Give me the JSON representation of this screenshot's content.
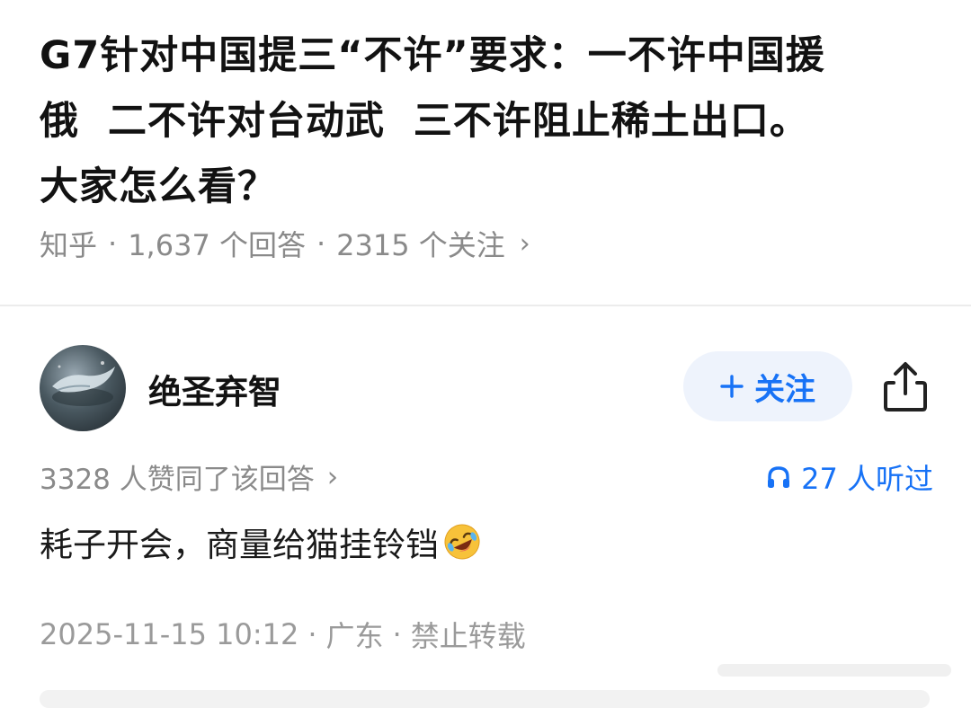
{
  "question": {
    "title_line1": "G7针对中国提三“不许”要求：一不许中国援",
    "title_line2": "俄  二不许对台动武  三不许阻止稀土出口。",
    "title_line3": "大家怎么看？",
    "source": "知乎",
    "answer_count": "1,637 个回答",
    "follow_count": "2315 个关注"
  },
  "author": {
    "name": "绝圣弃智",
    "follow_label": "关注"
  },
  "answer": {
    "votes": "3328 人赞同了该回答",
    "listened": "27 人听过",
    "text": "耗子开会，商量给猫挂铃铛",
    "timestamp": "2025-11-15 10:12",
    "location": "广东",
    "rights": "禁止转载"
  },
  "colors": {
    "accent": "#1772f6",
    "muted": "#8a8a8a",
    "follow_bg": "#eef3fc"
  },
  "icons": [
    "plus-icon",
    "share-icon",
    "chevron-right-icon",
    "headphones-icon",
    "rofl-emoji-icon"
  ]
}
